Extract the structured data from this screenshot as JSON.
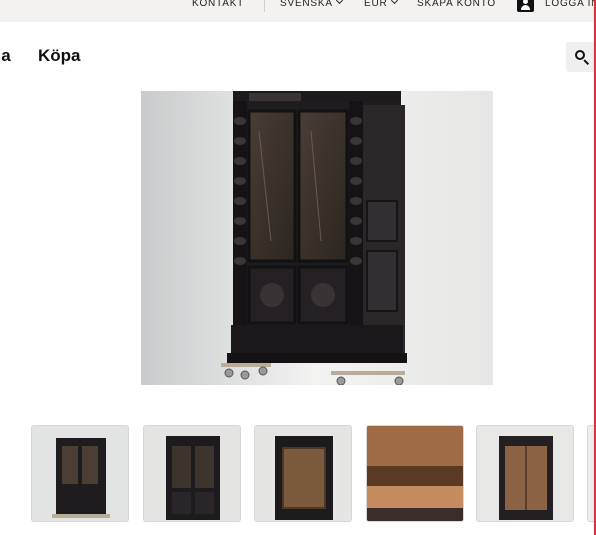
{
  "topbar": {
    "contact": "KONTAKT",
    "language": "SVENSKA",
    "currency": "EUR",
    "create_account": "SKAPA KONTO",
    "login": "LOGGA IN"
  },
  "nav": {
    "partial_item": "Sälja",
    "buy": "Köpa"
  },
  "icons": {
    "search": "search-icon",
    "user": "user-icon",
    "chevron": "chevron-down-icon"
  },
  "gallery": {
    "thumbnail_count": 5
  }
}
